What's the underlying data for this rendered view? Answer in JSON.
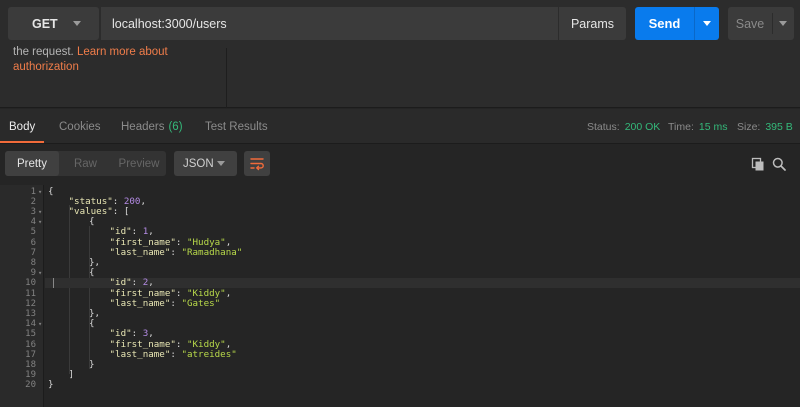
{
  "request": {
    "method": "GET",
    "url": "localhost:3000/users",
    "params_label": "Params",
    "send_label": "Send",
    "save_label": "Save"
  },
  "auth": {
    "text": "the request. ",
    "link": "Learn more about authorization"
  },
  "response_tabs": {
    "body": "Body",
    "cookies": "Cookies",
    "headers": "Headers",
    "headers_count": "(6)",
    "test_results": "Test Results"
  },
  "status": {
    "status_label": "Status:",
    "status_value": "200 OK",
    "time_label": "Time:",
    "time_value": "15 ms",
    "size_label": "Size:",
    "size_value": "395 B"
  },
  "view": {
    "pretty": "Pretty",
    "raw": "Raw",
    "preview": "Preview",
    "format": "JSON"
  },
  "colors": {
    "accent_orange": "#f26b3a",
    "send_blue": "#097bed",
    "success_green": "#34b97a"
  },
  "icons": {
    "wrap": "wrap-lines-icon",
    "copy": "copy-icon",
    "search": "search-icon"
  },
  "code_lines": [
    {
      "num": "1",
      "fold": true,
      "indent": 0,
      "tokens": [
        {
          "t": "{",
          "c": "p"
        }
      ]
    },
    {
      "num": "2",
      "fold": false,
      "indent": 1,
      "tokens": [
        {
          "t": "\"status\"",
          "c": "k"
        },
        {
          "t": ": ",
          "c": "p"
        },
        {
          "t": "200",
          "c": "n"
        },
        {
          "t": ",",
          "c": "p"
        }
      ]
    },
    {
      "num": "3",
      "fold": true,
      "indent": 1,
      "tokens": [
        {
          "t": "\"values\"",
          "c": "k"
        },
        {
          "t": ": [",
          "c": "p"
        }
      ]
    },
    {
      "num": "4",
      "fold": true,
      "indent": 2,
      "tokens": [
        {
          "t": "{",
          "c": "p"
        }
      ]
    },
    {
      "num": "5",
      "fold": false,
      "indent": 3,
      "tokens": [
        {
          "t": "\"id\"",
          "c": "k"
        },
        {
          "t": ": ",
          "c": "p"
        },
        {
          "t": "1",
          "c": "n"
        },
        {
          "t": ",",
          "c": "p"
        }
      ]
    },
    {
      "num": "6",
      "fold": false,
      "indent": 3,
      "tokens": [
        {
          "t": "\"first_name\"",
          "c": "k"
        },
        {
          "t": ": ",
          "c": "p"
        },
        {
          "t": "\"Hudya\"",
          "c": "s"
        },
        {
          "t": ",",
          "c": "p"
        }
      ]
    },
    {
      "num": "7",
      "fold": false,
      "indent": 3,
      "tokens": [
        {
          "t": "\"last_name\"",
          "c": "k"
        },
        {
          "t": ": ",
          "c": "p"
        },
        {
          "t": "\"Ramadhana\"",
          "c": "s"
        }
      ]
    },
    {
      "num": "8",
      "fold": false,
      "indent": 2,
      "tokens": [
        {
          "t": "},",
          "c": "p"
        }
      ]
    },
    {
      "num": "9",
      "fold": true,
      "indent": 2,
      "tokens": [
        {
          "t": "{",
          "c": "p"
        }
      ]
    },
    {
      "num": "10",
      "fold": false,
      "indent": 3,
      "tokens": [
        {
          "t": "\"id\"",
          "c": "k"
        },
        {
          "t": ": ",
          "c": "p"
        },
        {
          "t": "2",
          "c": "n"
        },
        {
          "t": ",",
          "c": "p"
        }
      ]
    },
    {
      "num": "11",
      "fold": false,
      "indent": 3,
      "tokens": [
        {
          "t": "\"first_name\"",
          "c": "k"
        },
        {
          "t": ": ",
          "c": "p"
        },
        {
          "t": "\"Kiddy\"",
          "c": "s"
        },
        {
          "t": ",",
          "c": "p"
        }
      ]
    },
    {
      "num": "12",
      "fold": false,
      "indent": 3,
      "tokens": [
        {
          "t": "\"last_name\"",
          "c": "k"
        },
        {
          "t": ": ",
          "c": "p"
        },
        {
          "t": "\"Gates\"",
          "c": "s"
        }
      ]
    },
    {
      "num": "13",
      "fold": false,
      "indent": 2,
      "tokens": [
        {
          "t": "},",
          "c": "p"
        }
      ]
    },
    {
      "num": "14",
      "fold": true,
      "indent": 2,
      "tokens": [
        {
          "t": "{",
          "c": "p"
        }
      ]
    },
    {
      "num": "15",
      "fold": false,
      "indent": 3,
      "tokens": [
        {
          "t": "\"id\"",
          "c": "k"
        },
        {
          "t": ": ",
          "c": "p"
        },
        {
          "t": "3",
          "c": "n"
        },
        {
          "t": ",",
          "c": "p"
        }
      ]
    },
    {
      "num": "16",
      "fold": false,
      "indent": 3,
      "tokens": [
        {
          "t": "\"first_name\"",
          "c": "k"
        },
        {
          "t": ": ",
          "c": "p"
        },
        {
          "t": "\"Kiddy\"",
          "c": "s"
        },
        {
          "t": ",",
          "c": "p"
        }
      ]
    },
    {
      "num": "17",
      "fold": false,
      "indent": 3,
      "tokens": [
        {
          "t": "\"last_name\"",
          "c": "k"
        },
        {
          "t": ": ",
          "c": "p"
        },
        {
          "t": "\"atreides\"",
          "c": "s"
        }
      ]
    },
    {
      "num": "18",
      "fold": false,
      "indent": 2,
      "tokens": [
        {
          "t": "}",
          "c": "p"
        }
      ]
    },
    {
      "num": "19",
      "fold": false,
      "indent": 1,
      "tokens": [
        {
          "t": "]",
          "c": "p"
        }
      ]
    },
    {
      "num": "20",
      "fold": false,
      "indent": 0,
      "tokens": [
        {
          "t": "}",
          "c": "p"
        }
      ]
    }
  ],
  "active_line": "10"
}
